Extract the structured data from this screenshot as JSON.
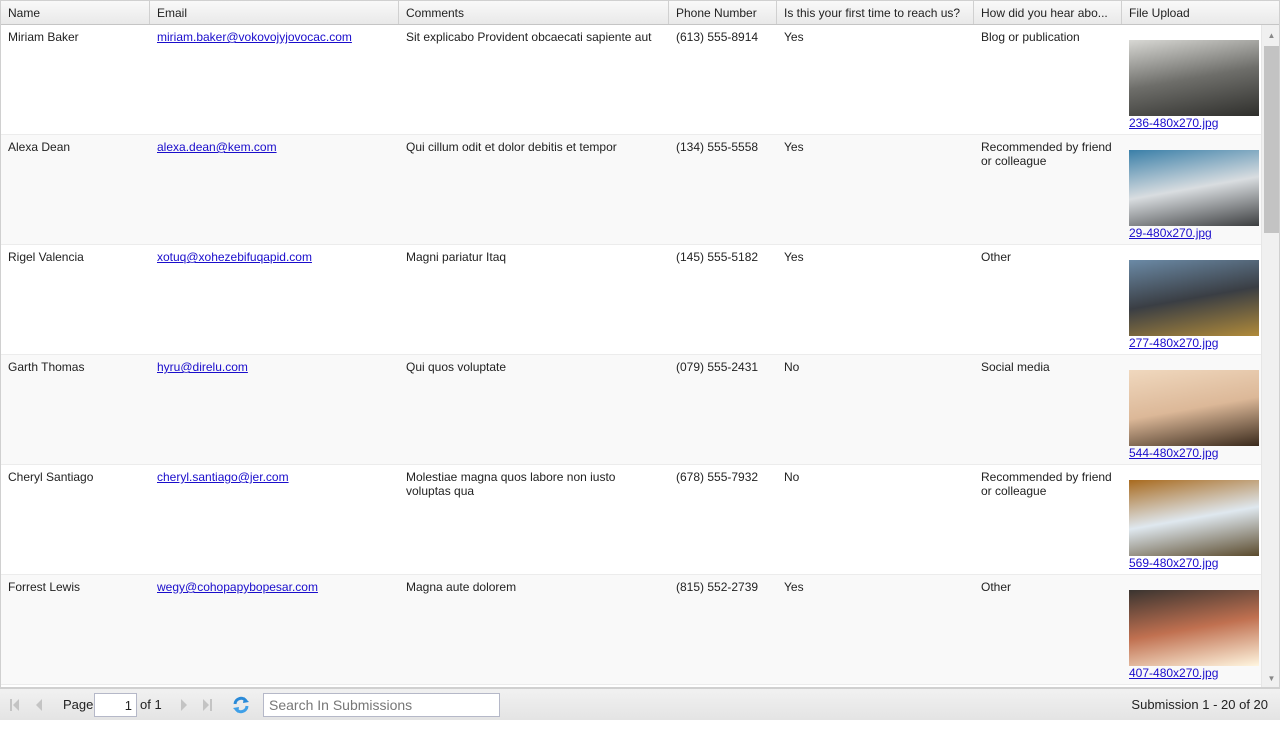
{
  "columns": [
    "Name",
    "Email",
    "Comments",
    "Phone Number",
    "Is this your first time to reach us?",
    "How did you hear abo...",
    "File Upload"
  ],
  "rows": [
    {
      "name": "Miriam Baker",
      "email": "miriam.baker@vokovojyjovocac.com",
      "comments": "Sit explicabo Provident obcaecati sapiente aut",
      "phone": "(613) 555-8914",
      "first_time": "Yes",
      "heard": "Blog or publication",
      "file": "236-480x270.jpg",
      "thumb_colors": [
        "#d8d8d4",
        "#6e6e6a",
        "#2f2f2c"
      ]
    },
    {
      "name": "Alexa Dean",
      "email": "alexa.dean@kem.com",
      "comments": "Qui cillum odit et dolor debitis et tempor",
      "phone": "(134) 555-5558",
      "first_time": "Yes",
      "heard": "Recommended by friend or colleague",
      "file": "29-480x270.jpg",
      "thumb_colors": [
        "#3a7fa8",
        "#d9dde0",
        "#3c3e40"
      ]
    },
    {
      "name": "Rigel Valencia",
      "email": "xotuq@xohezebifuqapid.com",
      "comments": "Magni pariatur Itaq",
      "phone": "(145) 555-5182",
      "first_time": "Yes",
      "heard": "Other",
      "file": "277-480x270.jpg",
      "thumb_colors": [
        "#6b8aa6",
        "#3a3e44",
        "#b08a3a"
      ]
    },
    {
      "name": "Garth Thomas",
      "email": "hyru@direlu.com",
      "comments": "Qui quos voluptate",
      "phone": "(079) 555-2431",
      "first_time": "No",
      "heard": "Social media",
      "file": "544-480x270.jpg",
      "thumb_colors": [
        "#f0d8be",
        "#dcb898",
        "#3a2a1c"
      ]
    },
    {
      "name": "Cheryl Santiago",
      "email": "cheryl.santiago@jer.com",
      "comments": "Molestiae magna quos labore non iusto voluptas qua",
      "phone": "(678) 555-7932",
      "first_time": "No",
      "heard": "Recommended by friend or colleague",
      "file": "569-480x270.jpg",
      "thumb_colors": [
        "#a86a1e",
        "#dfe8ef",
        "#5a4a2c"
      ]
    },
    {
      "name": "Forrest Lewis",
      "email": "wegy@cohopapybopesar.com",
      "comments": "Magna aute dolorem",
      "phone": "(815) 552-2739",
      "first_time": "Yes",
      "heard": "Other",
      "file": "407-480x270.jpg",
      "thumb_colors": [
        "#3a3430",
        "#c07050",
        "#fff6e0"
      ]
    }
  ],
  "toolbar": {
    "page_label": "Page",
    "page_value": "1",
    "of_label": "of 1",
    "search_placeholder": "Search In Submissions",
    "summary": "Submission 1 - 20 of 20"
  }
}
